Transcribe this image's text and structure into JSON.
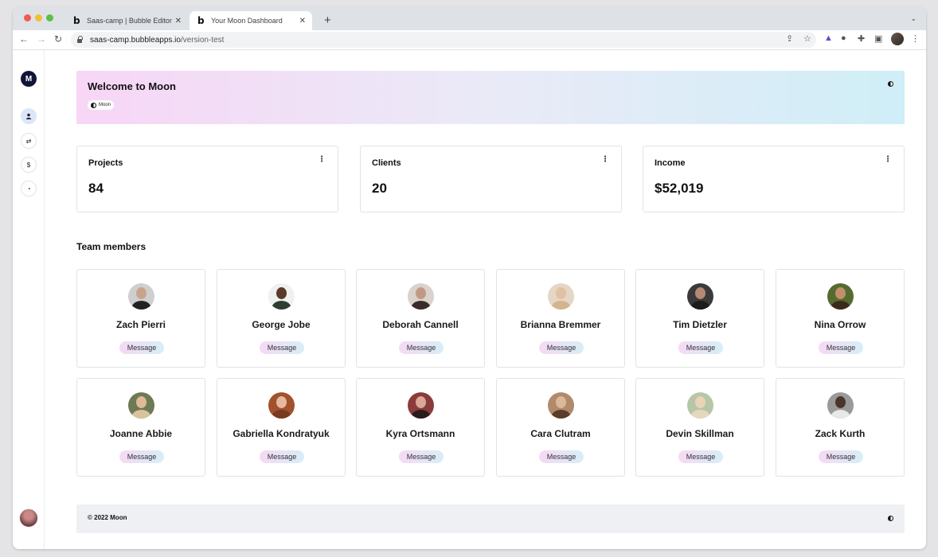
{
  "browser": {
    "tabs": [
      {
        "favicon": "b",
        "label": "Saas-camp | Bubble Editor",
        "active": false
      },
      {
        "favicon": "b",
        "label": "Your Moon Dashboard",
        "active": true
      }
    ],
    "url_host": "saas-camp.bubbleapps.io",
    "url_path": "/version-test"
  },
  "sidebar": {
    "logo": "M",
    "icons": [
      "user-icon",
      "swap-icon",
      "dollar-icon",
      "gauge-icon"
    ]
  },
  "hero": {
    "title": "Welcome to Moon",
    "chip": "Moon"
  },
  "stats": [
    {
      "label": "Projects",
      "value": "84"
    },
    {
      "label": "Clients",
      "value": "20"
    },
    {
      "label": "Income",
      "value": "$52,019"
    }
  ],
  "team": {
    "title": "Team members",
    "button_label": "Message",
    "members": [
      {
        "name": "Zach Pierri"
      },
      {
        "name": "George Jobe"
      },
      {
        "name": "Deborah Cannell"
      },
      {
        "name": "Brianna Bremmer"
      },
      {
        "name": "Tim Dietzler"
      },
      {
        "name": "Nina Orrow"
      },
      {
        "name": "Joanne Abbie"
      },
      {
        "name": "Gabriella Kondratyuk"
      },
      {
        "name": "Kyra Ortsmann"
      },
      {
        "name": "Cara Clutram"
      },
      {
        "name": "Devin Skillman"
      },
      {
        "name": "Zack Kurth"
      }
    ]
  },
  "footer": {
    "text": "© 2022 Moon"
  },
  "colors": {
    "accent_dark": "#11153a",
    "gradient_pink": "#f7d6f6",
    "gradient_blue": "#cfeef7",
    "sidebar_active": "#dbe6fb"
  }
}
